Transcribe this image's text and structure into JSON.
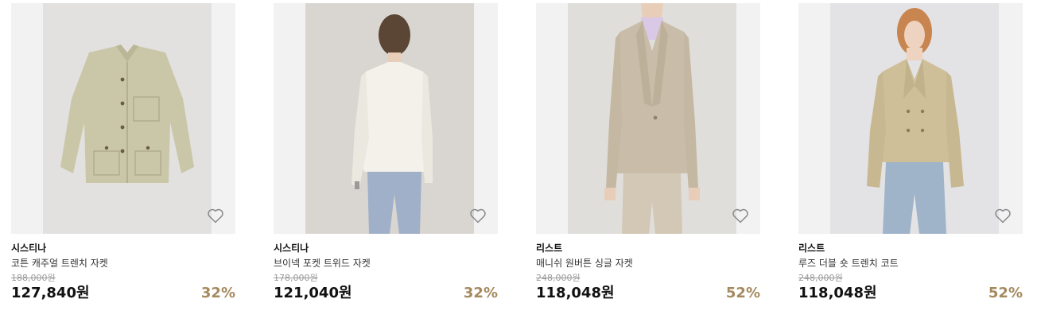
{
  "accent": {
    "discount": "#a58a5f"
  },
  "products": [
    {
      "brand": "시스티나",
      "name": "코튼 캐주얼 트렌치 자켓",
      "original_price": "188,000원",
      "price": "127,840원",
      "discount": "32%",
      "wish_icon": "heart-outline-icon"
    },
    {
      "brand": "시스티나",
      "name": "브이넥 포켓 트위드 자켓",
      "original_price": "178,000원",
      "price": "121,040원",
      "discount": "32%",
      "wish_icon": "heart-outline-icon"
    },
    {
      "brand": "리스트",
      "name": "매니쉬 원버튼 싱글 자켓",
      "original_price": "248,000원",
      "price": "118,048원",
      "discount": "52%",
      "wish_icon": "heart-outline-icon"
    },
    {
      "brand": "리스트",
      "name": "루즈 더블 숏 트렌치 코트",
      "original_price": "248,000원",
      "price": "118,048원",
      "discount": "52%",
      "wish_icon": "heart-outline-icon"
    }
  ]
}
